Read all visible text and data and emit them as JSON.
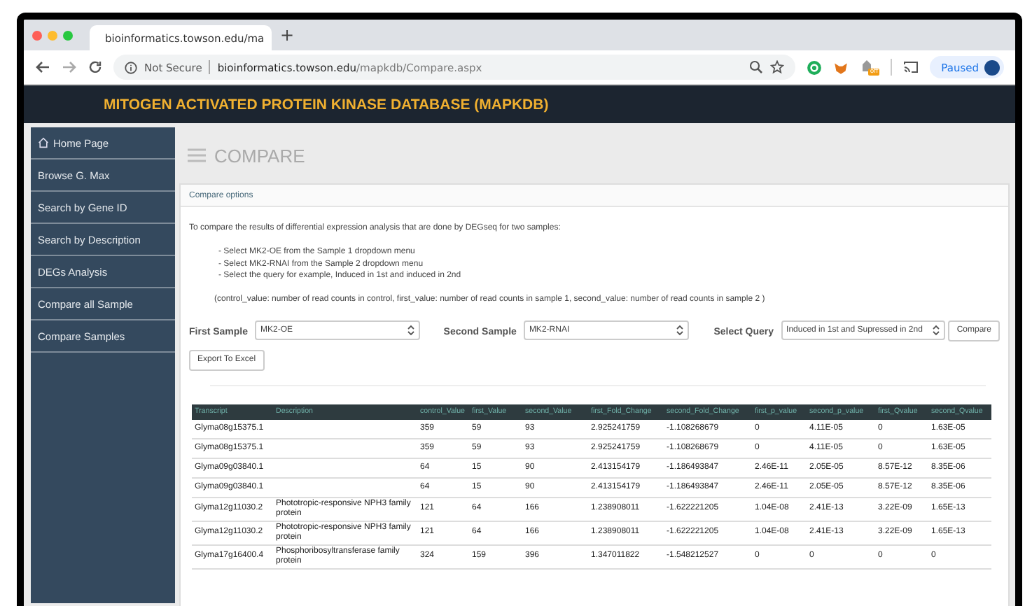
{
  "browser": {
    "tab_title": "bioinformatics.towson.edu/ma",
    "new_tab": "+",
    "security": "Not Secure",
    "url_domain": "bioinformatics.towson.edu",
    "url_path": "/mapkdb/Compare.aspx",
    "profile_button": "Paused",
    "extension_badge": "off"
  },
  "site_title": "MITOGEN ACTIVATED PROTEIN KINASE DATABASE (MAPKDB)",
  "sidebar": {
    "items": [
      {
        "label": "Home Page",
        "kind": "home",
        "selected": false
      },
      {
        "label": "Browse G. Max",
        "kind": "link",
        "selected": false
      },
      {
        "label": "Search by Gene ID",
        "kind": "link",
        "selected": false
      },
      {
        "label": "Search by Description",
        "kind": "link",
        "selected": false
      },
      {
        "label": "DEGs Analysis",
        "kind": "link",
        "selected": false
      },
      {
        "label": "Compare all Sample",
        "kind": "link",
        "selected": false
      },
      {
        "label": "Compare Samples",
        "kind": "link",
        "selected": false
      }
    ]
  },
  "page_title": "COMPARE",
  "panel": {
    "heading": "Compare options",
    "intro": "To compare the results of differential expression analysis that are done by DEGseq for two samples:",
    "steps": [
      "- Select MK2-OE from the Sample 1 dropdown menu",
      "- Select MK2-RNAI from the Sample 2 dropdown menu",
      "- Select the query for example, Induced in 1st and induced in 2nd"
    ],
    "note": "(control_value: number of read counts in control, first_value: number of read counts in sample 1, second_value: number of read counts in sample 2 )",
    "selects": [
      {
        "label": "First Sample",
        "value": "MK2-OE"
      },
      {
        "label": "Second Sample",
        "value": "MK2-RNAI"
      },
      {
        "label": "Select Query",
        "value": "Induced in 1st and Supressed in 2nd"
      }
    ],
    "compare_button": "Compare",
    "export_button": "Export To Excel"
  },
  "table": {
    "columns": [
      "Transcript",
      "Description",
      "control_Value",
      "first_Value",
      "second_Value",
      "first_Fold_Change",
      "second_Fold_Change",
      "first_p_value",
      "second_p_value",
      "first_Qvalue",
      "second_Qvalue"
    ],
    "rows": [
      [
        "Glyma08g15375.1",
        "",
        "359",
        "59",
        "93",
        "2.925241759",
        "-1.108268679",
        "0",
        "4.11E-05",
        "0",
        "1.63E-05"
      ],
      [
        "Glyma08g15375.1",
        "",
        "359",
        "59",
        "93",
        "2.925241759",
        "-1.108268679",
        "0",
        "4.11E-05",
        "0",
        "1.63E-05"
      ],
      [
        "Glyma09g03840.1",
        "",
        "64",
        "15",
        "90",
        "2.413154179",
        "-1.186493847",
        "2.46E-11",
        "2.05E-05",
        "8.57E-12",
        "8.35E-06"
      ],
      [
        "Glyma09g03840.1",
        "",
        "64",
        "15",
        "90",
        "2.413154179",
        "-1.186493847",
        "2.46E-11",
        "2.05E-05",
        "8.57E-12",
        "8.35E-06"
      ],
      [
        "Glyma12g11030.2",
        "Phototropic-responsive NPH3 family protein",
        "121",
        "64",
        "166",
        "1.238908011",
        "-1.622221205",
        "1.04E-08",
        "2.41E-13",
        "3.22E-09",
        "1.65E-13"
      ],
      [
        "Glyma12g11030.2",
        "Phototropic-responsive NPH3 family protein",
        "121",
        "64",
        "166",
        "1.238908011",
        "-1.622221205",
        "1.04E-08",
        "2.41E-13",
        "3.22E-09",
        "1.65E-13"
      ],
      [
        "Glyma17g16400.4",
        "Phosphoribosyltransferase family protein",
        "324",
        "159",
        "396",
        "1.347011822",
        "-1.548212527",
        "0",
        "0",
        "0",
        "0"
      ]
    ]
  }
}
